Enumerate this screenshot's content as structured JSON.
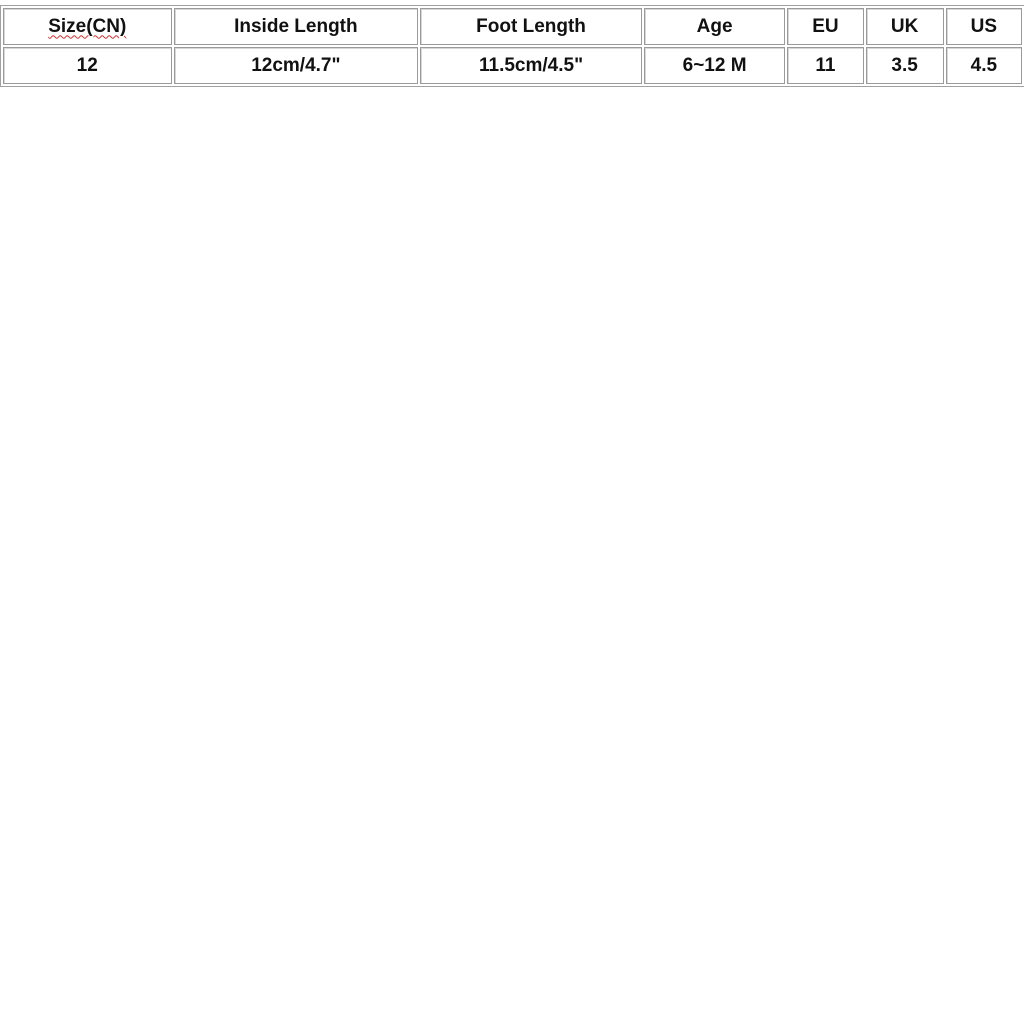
{
  "size_chart": {
    "headers": [
      "Size(CN)",
      "Inside Length",
      "Foot Length",
      "Age",
      "EU",
      "UK",
      "US"
    ],
    "rows": [
      [
        "12",
        "12cm/4.7\"",
        "11.5cm/4.5\"",
        "6~12 M",
        "11",
        "3.5",
        "4.5"
      ]
    ]
  }
}
